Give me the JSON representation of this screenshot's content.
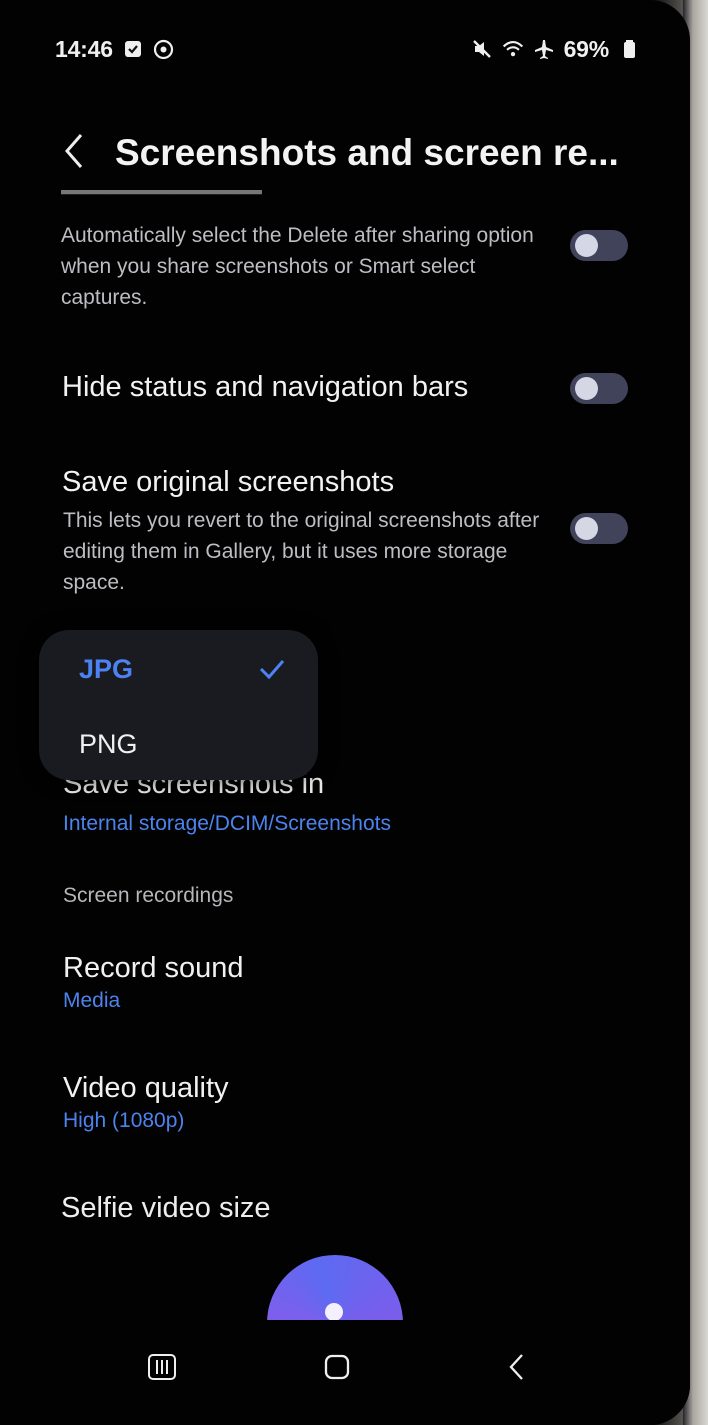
{
  "status_bar": {
    "time": "14:46",
    "battery": "69%"
  },
  "header": {
    "title": "Screenshots and screen re..."
  },
  "settings": {
    "delete_after_sharing": {
      "description": "Automatically select the Delete after sharing option when you share screenshots or Smart select captures."
    },
    "hide_bars": {
      "title": "Hide status and navigation bars"
    },
    "save_original": {
      "title": "Save original screenshots",
      "description": "This lets you revert to the original screenshots after editing them in Gallery, but it uses more storage space."
    }
  },
  "format_dropdown": {
    "options": [
      {
        "label": "JPG",
        "selected": true
      },
      {
        "label": "PNG",
        "selected": false
      }
    ]
  },
  "save_location": {
    "title": "Save screenshots in",
    "value": "Internal storage/DCIM/Screenshots"
  },
  "screen_recordings": {
    "section_title": "Screen recordings",
    "record_sound": {
      "title": "Record sound",
      "value": "Media"
    },
    "video_quality": {
      "title": "Video quality",
      "value": "High (1080p)"
    },
    "selfie_video_size": {
      "title": "Selfie video size"
    }
  },
  "colors": {
    "accent": "#4c83ee",
    "background": "#020202",
    "toggle_off": "#40435a",
    "popup": "#191b21"
  },
  "icons": {
    "back": "chevron-left-icon",
    "recents": "recent-apps-icon",
    "home": "home-icon",
    "check": "check-icon"
  }
}
